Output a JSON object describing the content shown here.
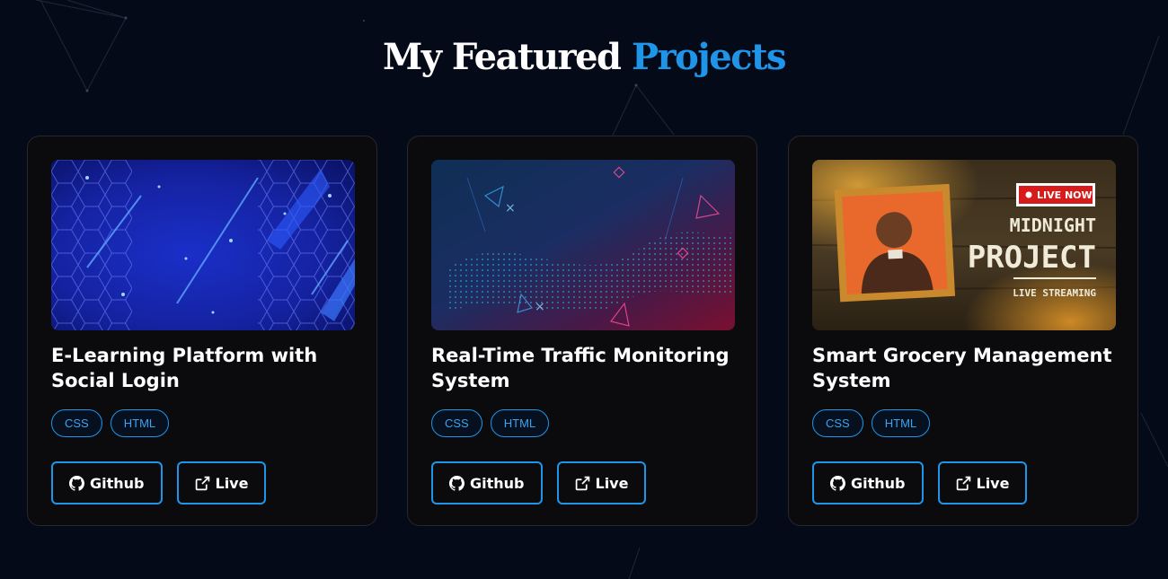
{
  "section": {
    "title_main": "My Featured",
    "title_accent": "Projects"
  },
  "colors": {
    "accent": "#1f95ea",
    "background": "#050a18",
    "card": "#0b0b0d"
  },
  "projects": [
    {
      "title": "E-Learning Platform with Social Login",
      "image": "blue-hexagon-tech-background",
      "tags": [
        "CSS",
        "HTML"
      ],
      "github_label": "Github",
      "live_label": "Live"
    },
    {
      "title": "Real-Time Traffic Monitoring System",
      "image": "particle-wave-network-background",
      "tags": [
        "CSS",
        "HTML"
      ],
      "github_label": "Github",
      "live_label": "Live"
    },
    {
      "title": "Smart Grocery Management System",
      "image": "midnight-project-live-stream-poster",
      "tags": [
        "CSS",
        "HTML"
      ],
      "github_label": "Github",
      "live_label": "Live"
    }
  ],
  "poster": {
    "badge": "LIVE NOW",
    "line1": "MIDNIGHT",
    "line2": "PROJECT",
    "line3": "LIVE STREAMING"
  },
  "icons": {
    "github": "github-icon",
    "live": "external-link-icon"
  }
}
